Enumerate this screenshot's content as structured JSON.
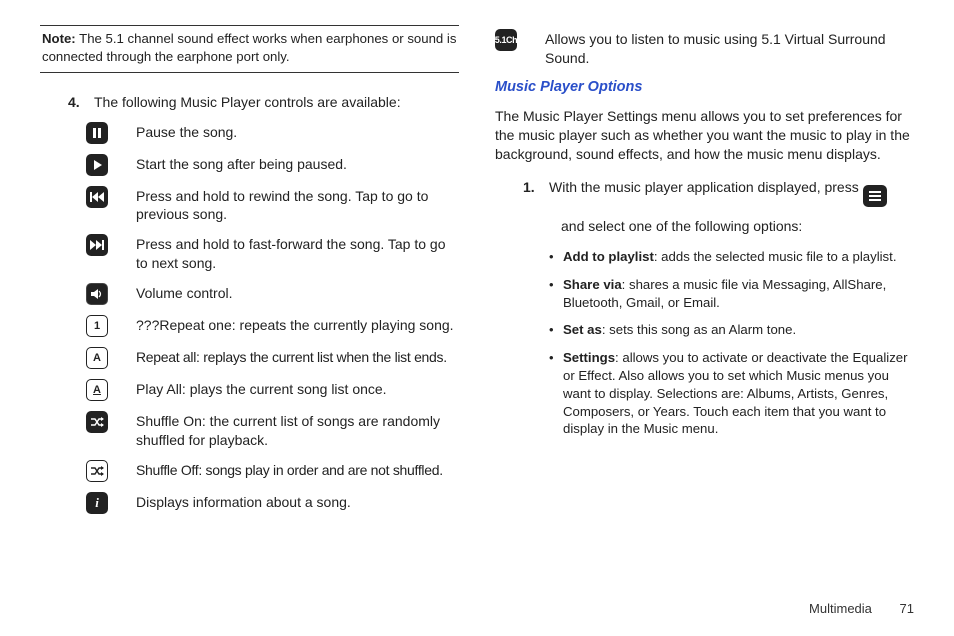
{
  "note": {
    "label": "Note:",
    "text": "The 5.1 channel sound effect works when earphones or sound is connected through the earphone port only."
  },
  "step4": {
    "num": "4.",
    "text": "The following Music Player controls are available:"
  },
  "controls": {
    "pause": "Pause the song.",
    "play": "Start the song after being paused.",
    "rewind": "Press and hold to rewind the song. Tap to go to previous song.",
    "forward": "Press and hold to fast-forward  the song. Tap to go to next song.",
    "volume": "Volume control.",
    "repeat1": "???Repeat one: repeats the currently playing song.",
    "repeatAll": "Repeat all: replays the current list when the list ends.",
    "playAll": "Play All: plays the current song list once.",
    "shuffleOn": "Shuffle On: the current list of songs are randomly shuffled for playback.",
    "shuffleOff": "Shuffle Off: songs play in order and are not shuffled.",
    "info": "Displays information about a song."
  },
  "surround": "Allows you to listen to music using 5.1 Virtual Surround Sound.",
  "section2": {
    "title": "Music Player Options",
    "intro": "The Music Player Settings menu allows you to set preferences for the music player such as whether you want the music to play in the background, sound effects, and how the music menu displays."
  },
  "step1": {
    "num": "1.",
    "textA": "With the music player application displayed, press ",
    "textB": "and select one of the following options:"
  },
  "options": {
    "add": {
      "label": "Add to playlist",
      "desc": ": adds the selected music file to a playlist."
    },
    "share": {
      "label": "Share via",
      "desc": ": shares a music file via Messaging, AllShare, Bluetooth, Gmail, or Email."
    },
    "setas": {
      "label": "Set as",
      "desc": ": sets this song as an Alarm tone."
    },
    "settings": {
      "label": "Settings",
      "desc": ": allows you to activate or deactivate the Equalizer or Effect. Also allows you to set which Music menus you want to display. Selections are: Albums, Artists, Genres, Composers, or Years. Touch each item that you want to display in the Music menu."
    }
  },
  "footer": {
    "section": "Multimedia",
    "page": "71"
  }
}
